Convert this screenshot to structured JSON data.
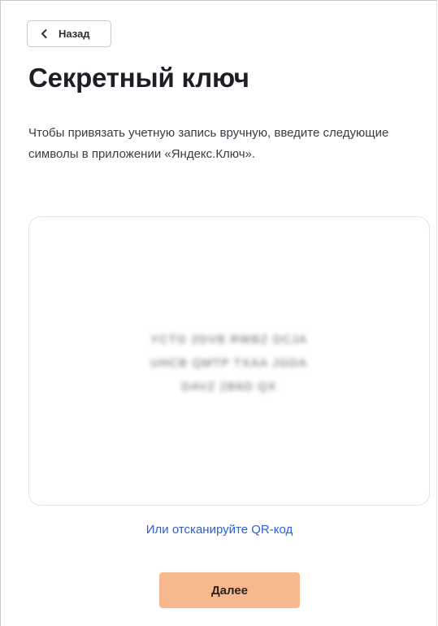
{
  "back_button": {
    "label": "Назад",
    "icon": "chevron-left-icon"
  },
  "title": "Секретный ключ",
  "description": "Чтобы привязать учетную запись вручную, введите следующие символы в приложении «Яндекс.Ключ».",
  "secret_key": {
    "blurred": true,
    "lines": [
      "YCTG 2DVB RWBZ DCJA",
      "UHCB QMTP TXAA JGDA",
      "DAVZ 2B6D QX"
    ]
  },
  "qr_link": "Или отсканируйте QR-код",
  "next_button": "Далее",
  "colors": {
    "accent_button": "#f8b88e",
    "link": "#2a61d6",
    "title": "#1c1f26"
  }
}
